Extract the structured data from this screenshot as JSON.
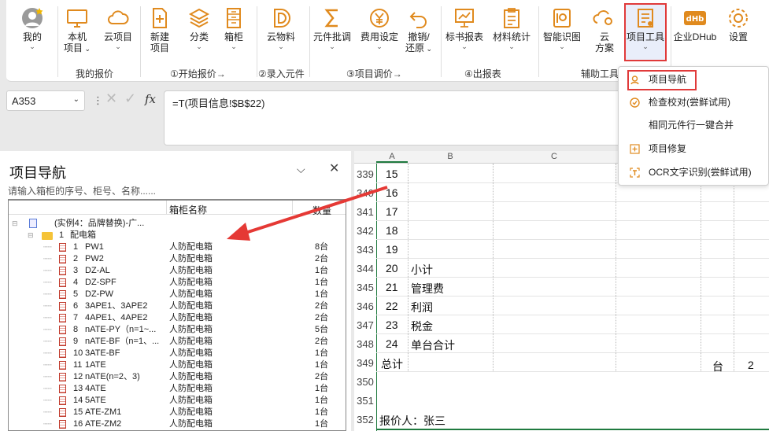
{
  "ribbon": {
    "buttons": [
      {
        "id": "mine",
        "label1": "我的",
        "label2": "",
        "dd": true
      },
      {
        "id": "local",
        "label1": "本机",
        "label2": "项目",
        "dd": true
      },
      {
        "id": "cloud",
        "label1": "云项目",
        "label2": "",
        "dd": true
      },
      {
        "id": "new",
        "label1": "新建",
        "label2": "项目",
        "dd": false
      },
      {
        "id": "cat",
        "label1": "分类",
        "label2": "",
        "dd": true
      },
      {
        "id": "box",
        "label1": "箱柜",
        "label2": "",
        "dd": true
      },
      {
        "id": "cloudmat",
        "label1": "云物料",
        "label2": "",
        "dd": true
      },
      {
        "id": "batch",
        "label1": "元件批调",
        "label2": "",
        "dd": true
      },
      {
        "id": "fee",
        "label1": "费用设定",
        "label2": "",
        "dd": true
      },
      {
        "id": "undo",
        "label1": "撤销/",
        "label2": "还原",
        "dd": true
      },
      {
        "id": "bid",
        "label1": "标书报表",
        "label2": "",
        "dd": true
      },
      {
        "id": "mat",
        "label1": "材料统计",
        "label2": "",
        "dd": true
      },
      {
        "id": "ai",
        "label1": "智能识图",
        "label2": "",
        "dd": true
      },
      {
        "id": "cloudsol",
        "label1": "云",
        "label2": "方案",
        "dd": false
      },
      {
        "id": "tool",
        "label1": "项目工具",
        "label2": "",
        "dd": true
      },
      {
        "id": "dhub",
        "label1": "企业DHub",
        "label2": "",
        "dd": false
      },
      {
        "id": "settings",
        "label1": "设置",
        "label2": "",
        "dd": false
      }
    ],
    "groups": [
      "我的报价",
      "①开始报价→",
      "②录入元件",
      "③项目调价→",
      "④出报表",
      "辅助工具"
    ]
  },
  "formula": {
    "cell_ref": "A353",
    "formula": "=T(项目信息!$B$22)",
    "fx": "fx"
  },
  "nav": {
    "title": "项目导航",
    "search_placeholder": "请输入箱柜的序号、柜号、名称......",
    "col_name": "箱柜名称",
    "col_qty": "数量",
    "project": "(实例4：品牌替换)-广...",
    "folder_num": "1",
    "folder_name": "配电箱",
    "items": [
      {
        "n": "1",
        "id": "PW1",
        "name": "人防配电箱",
        "qty": "8台"
      },
      {
        "n": "2",
        "id": "PW2",
        "name": "人防配电箱",
        "qty": "2台"
      },
      {
        "n": "3",
        "id": "DZ-AL",
        "name": "人防配电箱",
        "qty": "1台"
      },
      {
        "n": "4",
        "id": "DZ-SPF",
        "name": "人防配电箱",
        "qty": "1台"
      },
      {
        "n": "5",
        "id": "DZ-PW",
        "name": "人防配电箱",
        "qty": "1台"
      },
      {
        "n": "6",
        "id": "3APE1、3APE2",
        "name": "人防配电箱",
        "qty": "2台"
      },
      {
        "n": "7",
        "id": "4APE1、4APE2",
        "name": "人防配电箱",
        "qty": "2台"
      },
      {
        "n": "8",
        "id": "nATE-PY（n=1~...",
        "name": "人防配电箱",
        "qty": "5台"
      },
      {
        "n": "9",
        "id": "nATE-BF（n=1、...",
        "name": "人防配电箱",
        "qty": "2台"
      },
      {
        "n": "10",
        "id": "3ATE-BF",
        "name": "人防配电箱",
        "qty": "1台"
      },
      {
        "n": "11",
        "id": "1ATE",
        "name": "人防配电箱",
        "qty": "1台"
      },
      {
        "n": "12",
        "id": "nATE(n=2、3)",
        "name": "人防配电箱",
        "qty": "2台"
      },
      {
        "n": "13",
        "id": "4ATE",
        "name": "人防配电箱",
        "qty": "1台"
      },
      {
        "n": "14",
        "id": "5ATE",
        "name": "人防配电箱",
        "qty": "1台"
      },
      {
        "n": "15",
        "id": "ATE-ZM1",
        "name": "人防配电箱",
        "qty": "1台"
      },
      {
        "n": "16",
        "id": "ATE-ZM2",
        "name": "人防配电箱",
        "qty": "1台"
      }
    ]
  },
  "sheet": {
    "cols": [
      "A",
      "B",
      "C"
    ],
    "rows": [
      {
        "r": "339",
        "a": "15",
        "b": ""
      },
      {
        "r": "340",
        "a": "16",
        "b": ""
      },
      {
        "r": "341",
        "a": "17",
        "b": ""
      },
      {
        "r": "342",
        "a": "18",
        "b": ""
      },
      {
        "r": "343",
        "a": "19",
        "b": ""
      },
      {
        "r": "344",
        "a": "20",
        "b": "小计"
      },
      {
        "r": "345",
        "a": "21",
        "b": "管理费"
      },
      {
        "r": "346",
        "a": "22",
        "b": "利润"
      },
      {
        "r": "347",
        "a": "23",
        "b": "税金"
      },
      {
        "r": "348",
        "a": "24",
        "b": "单台合计"
      },
      {
        "r": "349",
        "a": "总计",
        "b": ""
      },
      {
        "r": "350",
        "a": "",
        "b": ""
      },
      {
        "r": "351",
        "a": "",
        "b": ""
      },
      {
        "r": "352",
        "a": "报价人：张三",
        "b": ""
      }
    ],
    "total_unit": "台",
    "total_qty": "2"
  },
  "menu": {
    "items": [
      "项目导航",
      "检查校对(尝鲜试用)",
      "相同元件行一键合并",
      "项目修复",
      "OCR文字识别(尝鲜试用)"
    ]
  },
  "colors": {
    "highlight": "#e03a3a",
    "accent": "#e08a1e"
  }
}
